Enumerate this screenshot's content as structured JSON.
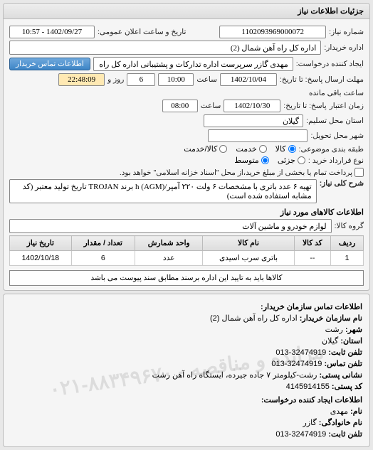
{
  "panel_title": "جزئیات اطلاعات نیاز",
  "fields": {
    "need_number_label": "شماره نیاز:",
    "need_number": "1102093969000072",
    "announce_datetime_label": "تاریخ و ساعت اعلان عمومی:",
    "announce_datetime": "1402/09/27 - 10:57",
    "buyer_org_label": "اداره خریدار:",
    "buyer_org": "اداره کل راه آهن شمال (2)",
    "requester_label": "ایجاد کننده درخواست:",
    "requester": "مهدی گازر سرپرست اداره تدارکات و پشتیبانی اداره کل راه آهن شمال (2)",
    "contact_btn": "اطلاعات تماس خریدار",
    "deadline_send_label": "مهلت ارسال پاسخ: تا تاریخ:",
    "deadline_send_date": "1402/10/04",
    "time_label": "ساعت",
    "deadline_send_time": "10:00",
    "day_and": "روز و",
    "days_remaining": "6",
    "countdown": "22:48:09",
    "remaining_label": "ساعت باقی مانده",
    "validity_label": "پاسخ: تا تاریخ:",
    "validity_prefix": "زمان اعتبار",
    "validity_date": "1402/10/30",
    "validity_time": "08:00",
    "province_label": "استان محل تسلیم:",
    "province": "گیلان",
    "city_label": "شهر محل تحویل:",
    "city": "",
    "budget_class_label": "طبقه بندی موضوعی:",
    "budget_opt_goods": "کالا",
    "budget_opt_service": "خدمت",
    "budget_opt_goods_service": "کالا/خدمت",
    "purchase_agree_label": "نوع قرارداد خرید :",
    "purchase_opt_small": "جزئی",
    "purchase_opt_medium": "متوسط",
    "purchase_note": "پرداخت تمام یا بخشی از مبلغ خرید،از محل \"اسناد خزانه اسلامی\" خواهد بود.",
    "general_title_label": "شرح کلی نیاز:",
    "general_title": "تهیه ۶ عدد باتری با مشخصات ۶ ولت ۲۲۰ آمپر/h (AGM) برند TROJAN تاریخ تولید معتبر (کد مشابه استفاده شده است)",
    "goods_section": "اطلاعات کالاهای مورد نیاز",
    "goods_group_label": "گروه کالا:",
    "goods_group": "لوازم خودرو و ماشین آلات",
    "note": "کالاها باید به تایید این اداره برسند مطابق سند پیوست می باشد"
  },
  "table": {
    "headers": [
      "ردیف",
      "کد کالا",
      "نام کالا",
      "واحد شمارش",
      "تعداد / مقدار",
      "تاریخ نیاز"
    ],
    "rows": [
      {
        "idx": "1",
        "code": "--",
        "name": "باتری سرب اسیدی",
        "unit": "عدد",
        "qty": "6",
        "date": "1402/10/18"
      }
    ]
  },
  "contact": {
    "header": "اطلاعات تماس سازمان خریدار:",
    "org_name_label": "نام سازمان خریدار:",
    "org_name": "اداره کل راه آهن شمال (2)",
    "city_label": "شهر:",
    "city": "رشت",
    "province_label": "استان:",
    "province": "گیلان",
    "phone_label": "تلفن ثابت:",
    "phone": "32474919-013",
    "fax_label": "تلفن تماس:",
    "fax": "32474919-013",
    "postal_label": "نشانی پستی:",
    "postal": "رشت-کیلومتر ۷ جاده جیرده، ایستگاه راه آهن رشت",
    "postcode_label": "کد پستی:",
    "postcode": "4145914155",
    "requester_header": "اطلاعات ایجاد کننده درخواست:",
    "name_label": "نام:",
    "name": "مهدی",
    "family_label": "نام خانوادگی:",
    "family": "گازر",
    "req_phone_label": "تلفن ثابت:",
    "req_phone": "32474919-013",
    "watermark": "۰۲۱-۸۸۳۴۹۶۷۰ - مزایده و مناقصه"
  }
}
